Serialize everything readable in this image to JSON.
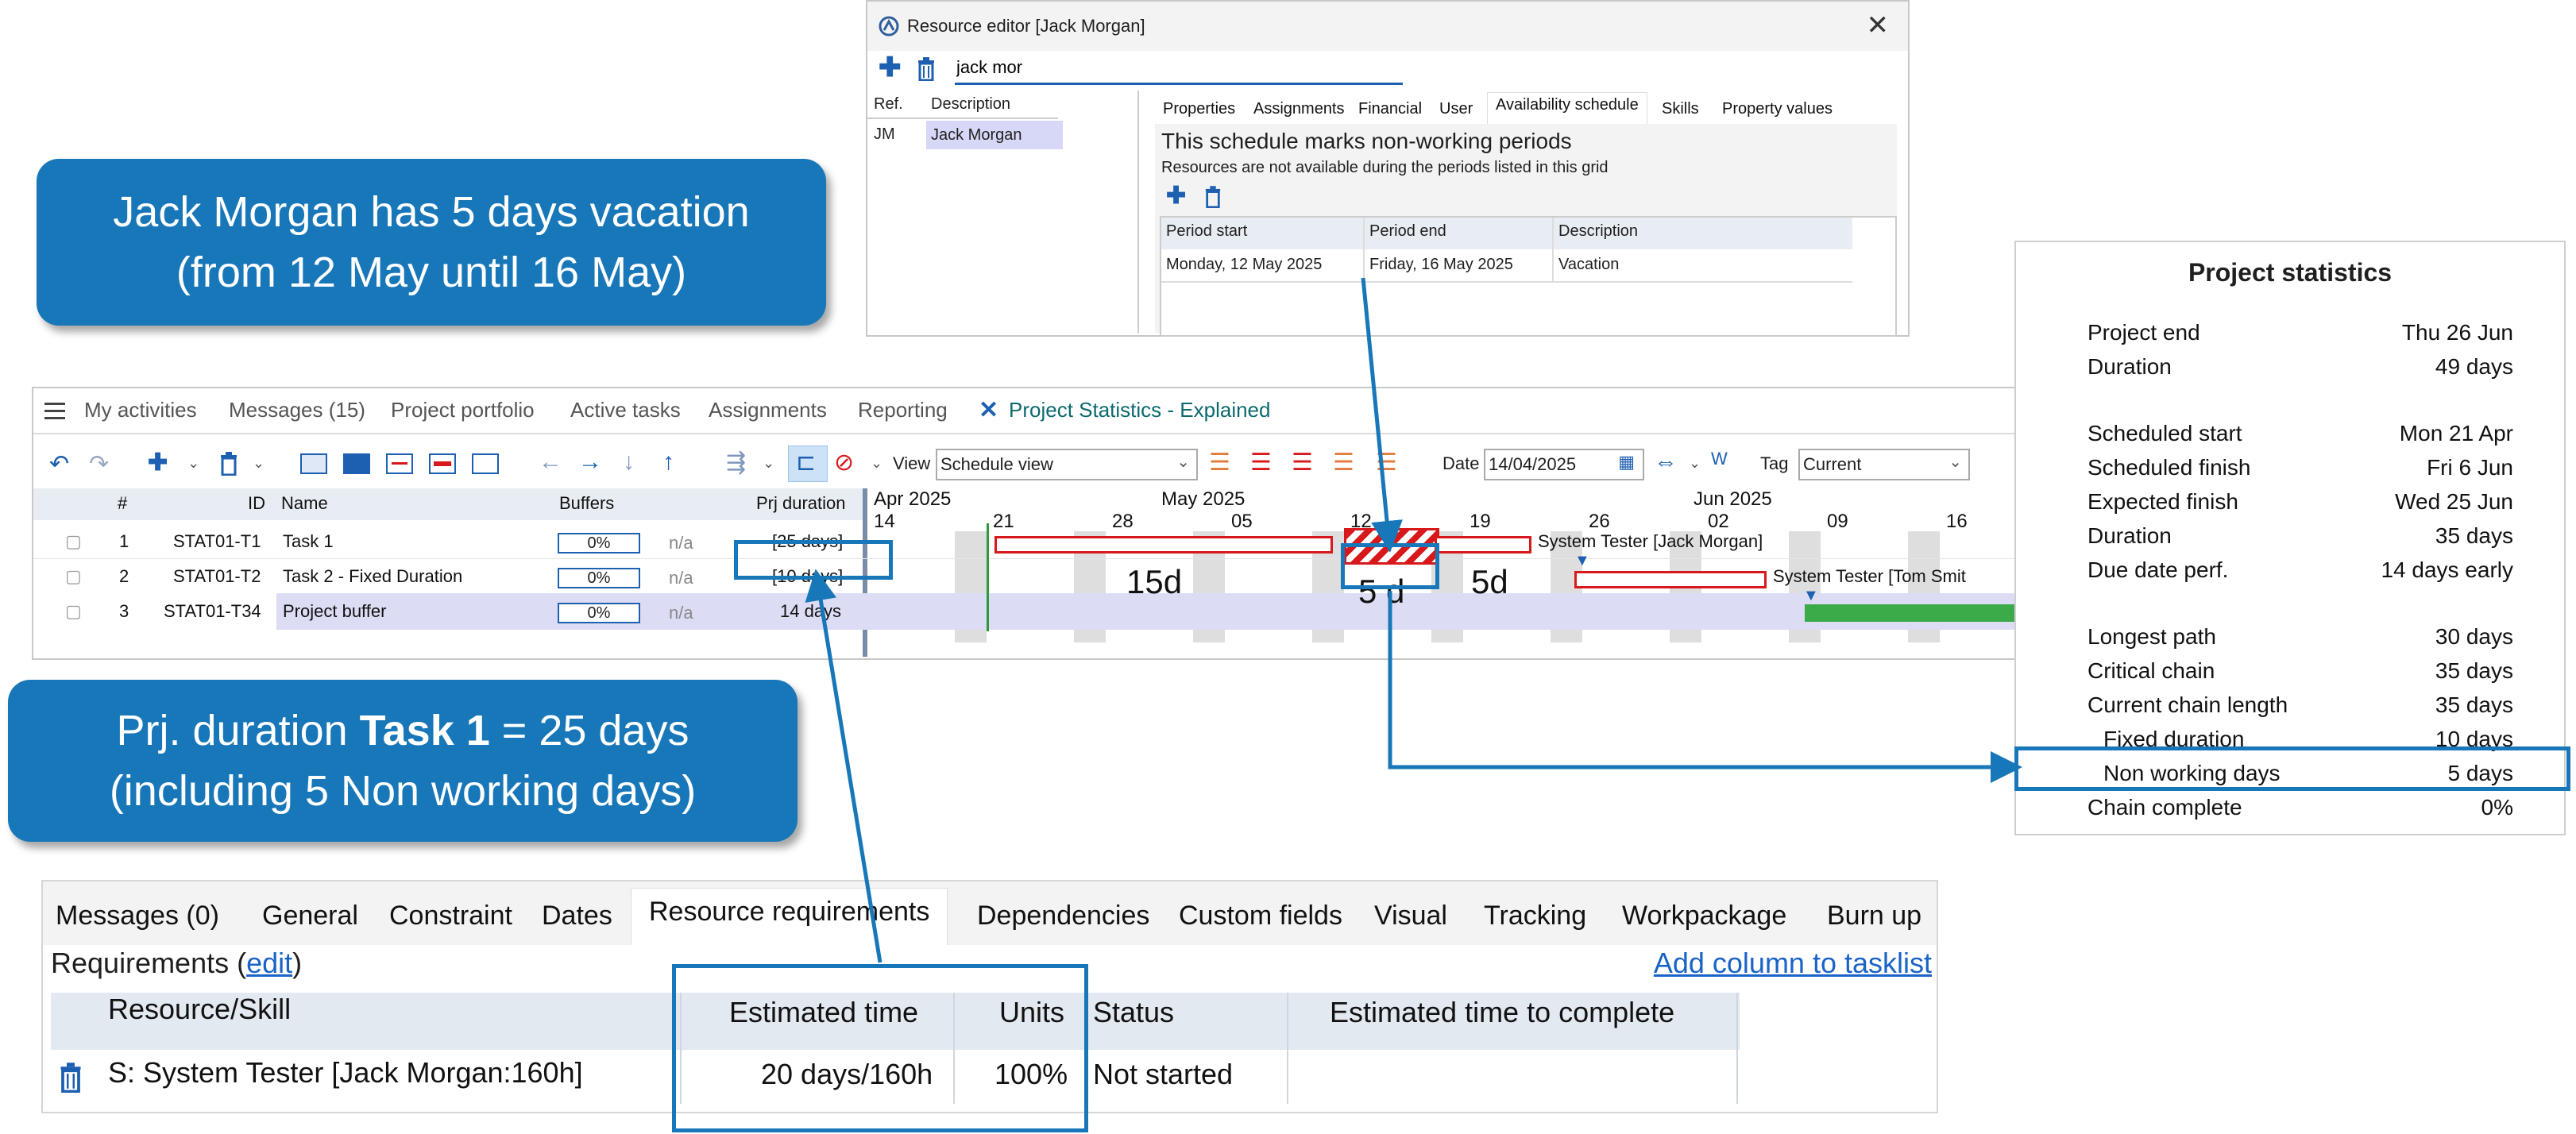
{
  "callouts": {
    "vacation_line1": "Jack Morgan has 5 days vacation",
    "vacation_line2": "(from 12 May until 16 May)",
    "duration_prefix": "Prj. duration ",
    "duration_task": "Task 1",
    "duration_suffix": " = 25 days",
    "duration_line2": "(including 5 Non working days)"
  },
  "resource_editor": {
    "title": "Resource editor [Jack Morgan]",
    "search_value": "jack mor",
    "left_headers": [
      "Ref.",
      "Description"
    ],
    "left_row": [
      "JM",
      "Jack Morgan"
    ],
    "tabs": [
      "Properties",
      "Assignments",
      "Financial",
      "User",
      "Availability schedule",
      "Skills",
      "Property values"
    ],
    "heading": "This schedule marks non-working periods",
    "subheading": "Resources are not available during the periods listed in this grid",
    "grid_headers": [
      "Period start",
      "Period end",
      "Description"
    ],
    "grid_row": [
      "Monday, 12 May 2025",
      "Friday, 16 May 2025",
      "Vacation"
    ]
  },
  "app": {
    "nav_tabs": [
      "My activities",
      "Messages (15)",
      "Project portfolio",
      "Active tasks",
      "Assignments",
      "Reporting"
    ],
    "active_tab": "Project Statistics - Explained",
    "view_label": "View",
    "view_value": "Schedule view",
    "date_label": "Date",
    "date_value": "14/04/2025",
    "tag_label": "Tag",
    "tag_value": "Current",
    "grid_headers": [
      "#",
      "ID",
      "Name",
      "Buffers",
      "Prj duration"
    ],
    "months": [
      "Apr 2025",
      "May 2025",
      "Jun 2025"
    ],
    "days": [
      "14",
      "21",
      "28",
      "05",
      "12",
      "19",
      "26",
      "02",
      "09",
      "16"
    ],
    "rows": [
      {
        "num": "1",
        "id": "STAT01-T1",
        "name": "Task 1",
        "buffer": "0%",
        "na": "n/a",
        "duration": "[25 days]"
      },
      {
        "num": "2",
        "id": "STAT01-T2",
        "name": "Task 2 - Fixed Duration",
        "buffer": "0%",
        "na": "n/a",
        "duration": "[10 days]"
      },
      {
        "num": "3",
        "id": "STAT01-T34",
        "name": "Project buffer",
        "buffer": "0%",
        "na": "n/a",
        "duration": "14 days"
      }
    ],
    "gantt_labels": {
      "d15": "15d",
      "d5a": "5 d",
      "d5b": "5d",
      "tester1": "System Tester [Jack Morgan]",
      "tester2": "System Tester [Tom Smit"
    }
  },
  "stats": {
    "title": "Project statistics",
    "groups": [
      [
        {
          "label": "Project end",
          "value": "Thu 26 Jun"
        },
        {
          "label": "Duration",
          "value": "49 days"
        }
      ],
      [
        {
          "label": "Scheduled start",
          "value": "Mon 21 Apr"
        },
        {
          "label": "Scheduled finish",
          "value": "Fri 6 Jun"
        },
        {
          "label": "Expected finish",
          "value": "Wed 25 Jun"
        },
        {
          "label": "Duration",
          "value": "35 days"
        },
        {
          "label": "Due date perf.",
          "value": "14 days early"
        }
      ],
      [
        {
          "label": "Longest path",
          "value": "30 days"
        },
        {
          "label": "Critical chain",
          "value": "35 days"
        },
        {
          "label": "Current chain length",
          "value": "35 days"
        },
        {
          "label": "Fixed duration",
          "value": "10 days"
        },
        {
          "label": "Non working days",
          "value": "5 days"
        },
        {
          "label": "Chain complete",
          "value": "0%"
        }
      ]
    ]
  },
  "bottom": {
    "tabs": [
      "Messages (0)",
      "General",
      "Constraint",
      "Dates",
      "Resource requirements",
      "Dependencies",
      "Custom fields",
      "Visual",
      "Tracking",
      "Workpackage",
      "Burn up"
    ],
    "req_label": "Requirements (",
    "edit_link": "edit",
    "req_close": ")",
    "add_column": "Add column to tasklist",
    "headers": [
      "Resource/Skill",
      "Estimated time",
      "Units",
      "Status",
      "Estimated time to complete"
    ],
    "row": [
      "S: System Tester [Jack Morgan:160h]",
      "20 days/160h",
      "100%",
      "Not started",
      ""
    ]
  },
  "colors": {
    "accent": "#1877b8",
    "bar_red": "#d7191c",
    "bar_green": "#3bab4a",
    "buffer_row": "#dcdcf5"
  }
}
